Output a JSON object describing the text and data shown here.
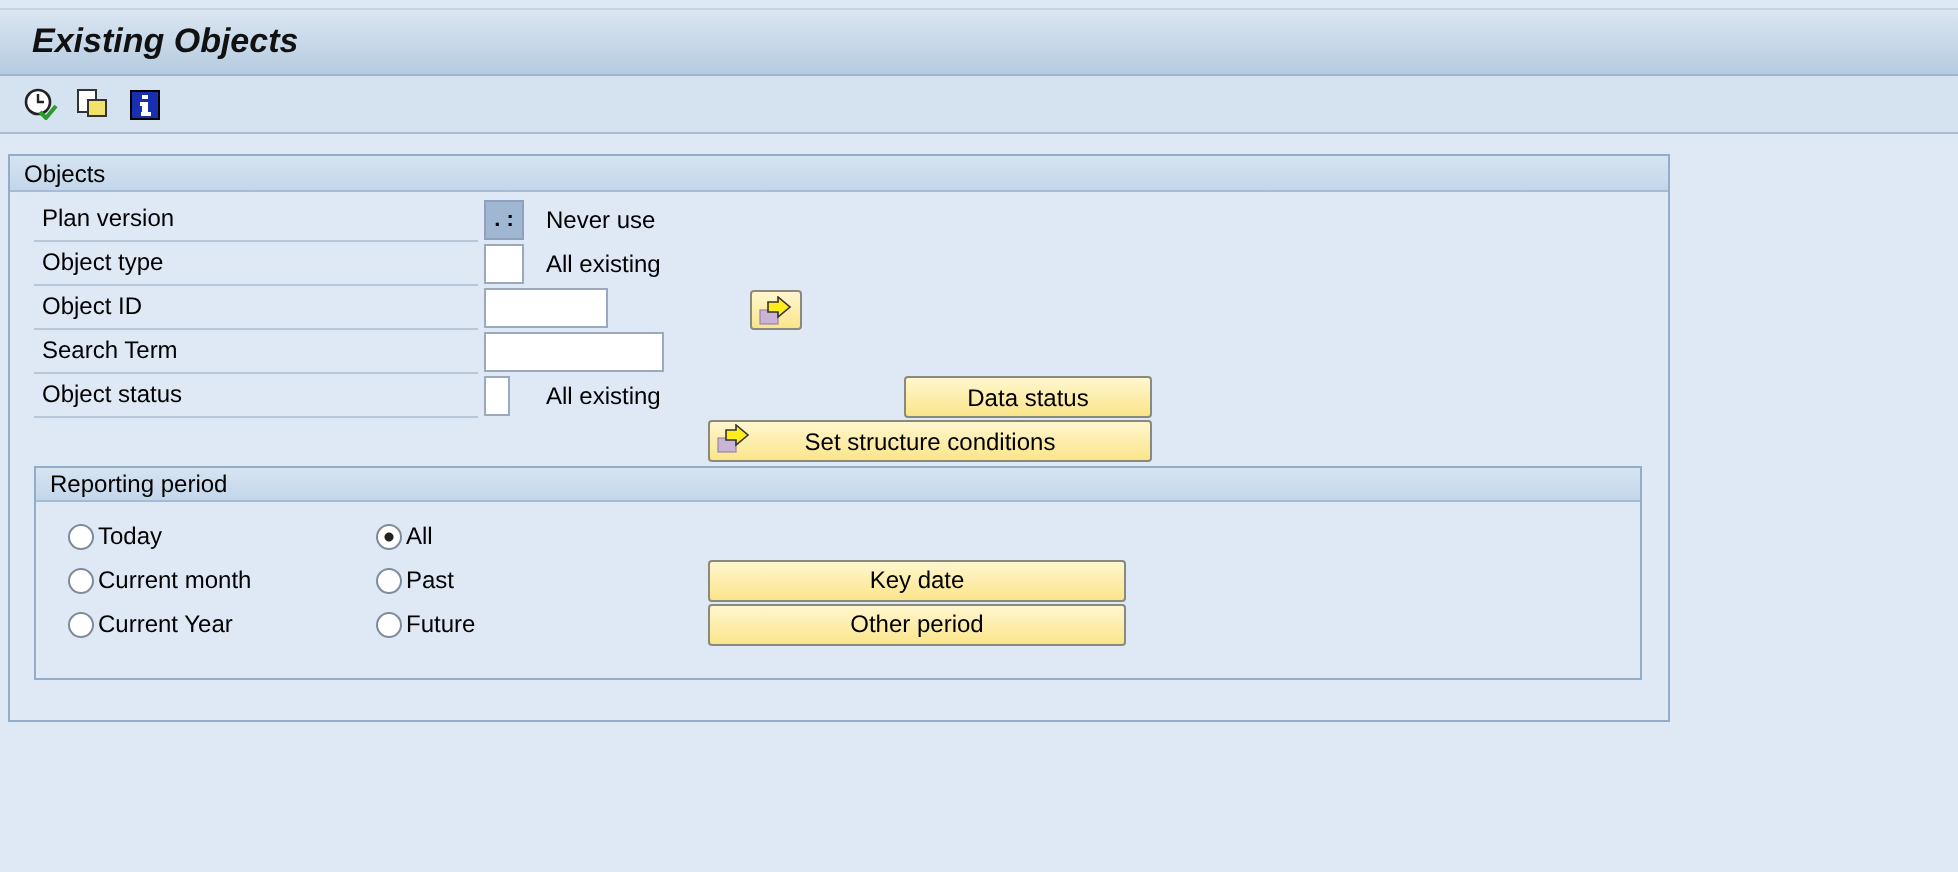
{
  "window": {
    "title": "Existing Objects"
  },
  "toolbar": {
    "icons": [
      {
        "kind": "clock-check"
      },
      {
        "kind": "copy"
      },
      {
        "kind": "info"
      }
    ]
  },
  "objects": {
    "title": "Objects",
    "fields": [
      {
        "label": "Plan version",
        "kind": "selector",
        "value": ". :",
        "note": "Never use"
      },
      {
        "label": "Object type",
        "kind": "char",
        "note": "All existing"
      },
      {
        "label": "Object ID",
        "kind": "medium",
        "arrow_button": true
      },
      {
        "label": "Search Term",
        "kind": "long"
      },
      {
        "label": "Object status",
        "kind": "narrow",
        "note": "All existing",
        "button": "Data status"
      }
    ],
    "structure_button": "Set structure conditions"
  },
  "reporting_period": {
    "title": "Reporting period",
    "options": [
      {
        "label": "Today",
        "selected": false
      },
      {
        "label": "All",
        "selected": true
      },
      {
        "label": "Current month",
        "selected": false
      },
      {
        "label": "Past",
        "selected": false
      },
      {
        "label": "Current Year",
        "selected": false
      },
      {
        "label": "Future",
        "selected": false
      }
    ],
    "buttons": [
      "Key date",
      "Other period"
    ]
  }
}
